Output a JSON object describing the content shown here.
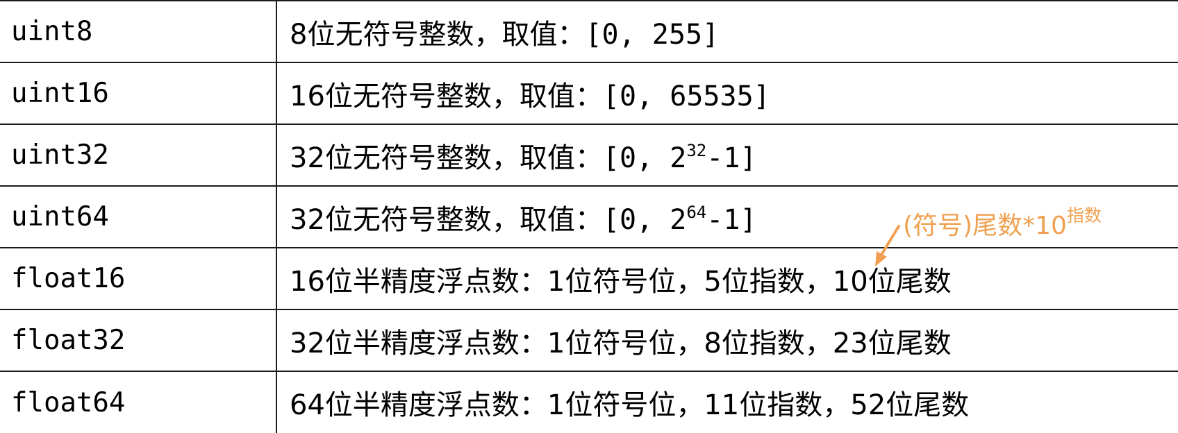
{
  "rows": [
    {
      "name": "uint8",
      "desc_text": "8位无符号整数，取值：",
      "range_prefix": "[0, ",
      "range_base": "255",
      "range_exp": "",
      "range_suffix": "]"
    },
    {
      "name": "uint16",
      "desc_text": "16位无符号整数，取值：",
      "range_prefix": "[0, ",
      "range_base": "65535",
      "range_exp": "",
      "range_suffix": "]"
    },
    {
      "name": "uint32",
      "desc_text": "32位无符号整数，取值：",
      "range_prefix": "[0, ",
      "range_base": "2",
      "range_exp": "32",
      "range_suffix": "-1]"
    },
    {
      "name": "uint64",
      "desc_text": "32位无符号整数，取值：",
      "range_prefix": "[0, ",
      "range_base": "2",
      "range_exp": "64",
      "range_suffix": "-1]"
    },
    {
      "name": "float16",
      "desc_text": "16位半精度浮点数：1位符号位，5位指数，10位尾数"
    },
    {
      "name": "float32",
      "desc_text": "32位半精度浮点数：1位符号位，8位指数，23位尾数"
    },
    {
      "name": "float64",
      "desc_text": "64位半精度浮点数：1位符号位，11位指数，52位尾数"
    }
  ],
  "annotation": {
    "text": "(符号)尾数*10",
    "superscript": "指数",
    "color": "#f0a050"
  }
}
